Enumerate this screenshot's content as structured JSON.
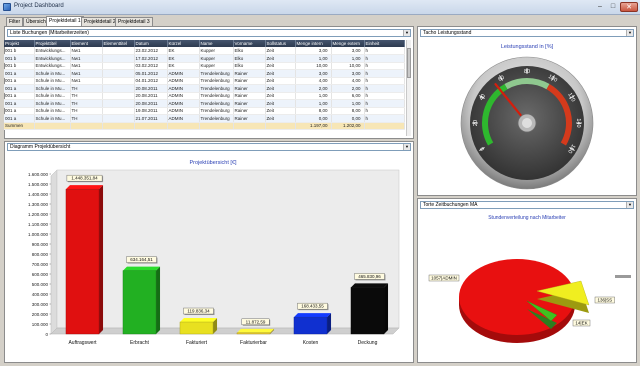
{
  "window": {
    "title": "Project Dashboard"
  },
  "tabs": [
    "Filter",
    "Übersicht",
    "Projektdetail 1",
    "Projektdetail 2",
    "Projektdetail 3"
  ],
  "bookings": {
    "selector": "Liste Buchungen (Mitarbeiterzeiten)",
    "columns": [
      "Projekt",
      "Projekttitel",
      "Element",
      "Elementtitel",
      "Datum",
      "Kürzel",
      "Name",
      "Vorname",
      "Sollstatus",
      "Menge intern",
      "Menge extern",
      "Einheit"
    ],
    "rows": [
      [
        "001 b",
        "Entwicklungs...",
        "Nw1",
        "",
        "23.02.2012",
        "EK",
        "Kupper",
        "Elko",
        "Zeit",
        "3,00",
        "3,00",
        "h"
      ],
      [
        "001 b",
        "Entwicklungs...",
        "Nw1",
        "",
        "17.02.2012",
        "EK",
        "Kupper",
        "Elko",
        "Zeit",
        "1,00",
        "1,00",
        "h"
      ],
      [
        "001 b",
        "Entwicklungs...",
        "Nw1",
        "",
        "03.02.2012",
        "EK",
        "Kupper",
        "Elko",
        "Zeit",
        "10,00",
        "10,00",
        "h"
      ],
      [
        "001 a",
        "Schule in Mu...",
        "Nw1",
        "",
        "05.01.2012",
        "ADMIN",
        "Trendelenburg",
        "Rainer",
        "Zeit",
        "3,00",
        "3,00",
        "h"
      ],
      [
        "001 a",
        "Schule in Mu...",
        "Nw1",
        "",
        "04.01.2012",
        "ADMIN",
        "Trendelenburg",
        "Rainer",
        "Zeit",
        "4,00",
        "4,00",
        "h"
      ],
      [
        "001 a",
        "Schule in Mu...",
        "TH",
        "",
        "20.08.2011",
        "ADMIN",
        "Trendelenburg",
        "Rainer",
        "Zeit",
        "2,00",
        "2,00",
        "h"
      ],
      [
        "001 a",
        "Schule in Mu...",
        "TH",
        "",
        "20.08.2011",
        "ADMIN",
        "Trendelenburg",
        "Rainer",
        "Zeit",
        "1,00",
        "6,00",
        "h"
      ],
      [
        "001 a",
        "Schule in Mu...",
        "TH",
        "",
        "20.08.2011",
        "ADMIN",
        "Trendelenburg",
        "Rainer",
        "Zeit",
        "1,00",
        "1,00",
        "h"
      ],
      [
        "001 a",
        "Schule in Mu...",
        "TH",
        "",
        "19.08.2011",
        "ADMIN",
        "Trendelenburg",
        "Rainer",
        "Zeit",
        "8,00",
        "8,00",
        "h"
      ],
      [
        "001 a",
        "Schule in Mu...",
        "TH",
        "",
        "21.07.2011",
        "ADMIN",
        "Trendelenburg",
        "Rainer",
        "Zeit",
        "0,00",
        "0,00",
        "h"
      ]
    ],
    "summary": {
      "label": "Summen",
      "intern": "1.197,00",
      "extern": "1.202,00"
    }
  },
  "tacho": {
    "selector": "Tacho Leistungsstand",
    "title": "Leistungsstand in [%]",
    "ticks": [
      "0",
      "20",
      "40",
      "60",
      "80",
      "100",
      "120",
      "140",
      "160"
    ],
    "value_percent": 54
  },
  "pie": {
    "selector": "Torte Zeitbuchungen MA",
    "title": "Stundenverteilung nach Mitarbeiter",
    "labels": [
      "1057|ADMIN",
      "136|SS",
      "14|EK"
    ]
  },
  "diagram": {
    "selector": "Diagramm Projektübersicht"
  },
  "chart_data": {
    "type": "bar",
    "title": "Projektübersicht [€]",
    "categories": [
      "Auftragswert",
      "Erbracht",
      "Fakturiert",
      "Fakturierbar",
      "Kosten",
      "Deckung"
    ],
    "values": [
      1448351.84,
      634164.51,
      119836.34,
      11872.59,
      168433.55,
      465830.96
    ],
    "value_labels": [
      "1.448.351,84",
      "634.164,51",
      "119.836,34",
      "11.872,59",
      "168.433,55",
      "465.830,96"
    ],
    "colors": [
      "#e01010",
      "#22b022",
      "#e8e020",
      "#e8c830",
      "#1030d0",
      "#0a0a0a"
    ],
    "ylim": [
      0,
      1600000
    ],
    "yticks": [
      "0",
      "100.000",
      "200.000",
      "300.000",
      "400.000",
      "500.000",
      "600.000",
      "700.000",
      "800.000",
      "900.000",
      "1.000.000",
      "1.100.000",
      "1.200.000",
      "1.300.000",
      "1.400.000",
      "1.500.000",
      "1.600.000"
    ],
    "grid": false
  }
}
